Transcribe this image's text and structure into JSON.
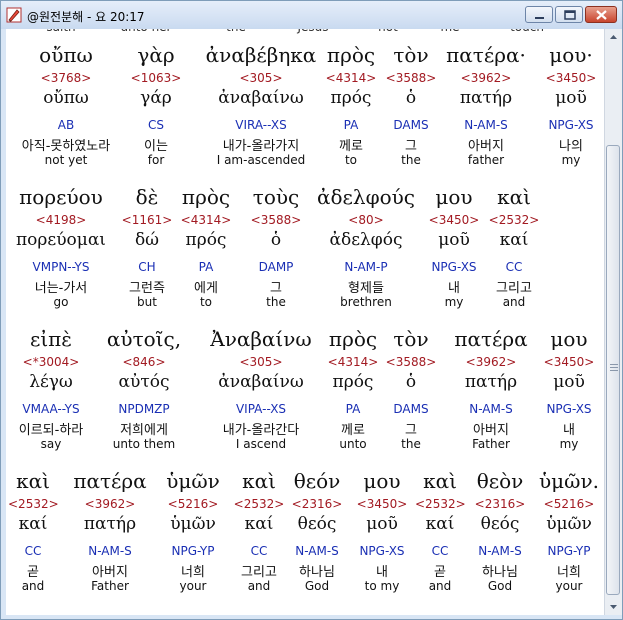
{
  "window": {
    "title": "@원전분해 - 요 20:17",
    "minimize_icon": "minimize-icon",
    "maximize_icon": "maximize-icon",
    "close_icon": "close-icon",
    "app_icon": "app-pencil-icon"
  },
  "previous_line": {
    "words": [
      "saith",
      "unto her",
      "the",
      "Jesus",
      "not",
      "me",
      "touch"
    ]
  },
  "lines": [
    {
      "words": [
        {
          "greek": "οὔπω",
          "strong": "<3768>",
          "lemma": "οὔπω",
          "morph": "AB",
          "korean": "아직-못하였노라",
          "english": "not yet"
        },
        {
          "greek": "γὰρ",
          "strong": "<1063>",
          "lemma": "γάρ",
          "morph": "CS",
          "korean": "이는",
          "english": "for"
        },
        {
          "greek": "ἀναβέβηκα",
          "strong": "<305>",
          "lemma": "ἀναβαίνω",
          "morph": "VIRA--XS",
          "korean": "내가-올라가지",
          "english": "I am-ascended"
        },
        {
          "greek": "πρὸς",
          "strong": "<4314>",
          "lemma": "πρός",
          "morph": "PA",
          "korean": "께로",
          "english": "to"
        },
        {
          "greek": "τὸν",
          "strong": "<3588>",
          "lemma": "ὁ",
          "morph": "DAMS",
          "korean": "그",
          "english": "the"
        },
        {
          "greek": "πατέρα·",
          "strong": "<3962>",
          "lemma": "πατήρ",
          "morph": "N-AM-S",
          "korean": "아버지",
          "english": "father"
        },
        {
          "greek": "μου·",
          "strong": "<3450>",
          "lemma": "μοῦ",
          "morph": "NPG-XS",
          "korean": "나의",
          "english": "my"
        }
      ]
    },
    {
      "words": [
        {
          "greek": "πορεύου",
          "strong": "<4198>",
          "lemma": "πορεύομαι",
          "morph": "VMPN--YS",
          "korean": "너는-가서",
          "english": "go"
        },
        {
          "greek": "δὲ",
          "strong": "<1161>",
          "lemma": "δώ",
          "morph": "CH",
          "korean": "그런즉",
          "english": "but"
        },
        {
          "greek": "πρὸς",
          "strong": "<4314>",
          "lemma": "πρός",
          "morph": "PA",
          "korean": "에게",
          "english": "to"
        },
        {
          "greek": "τοὺς",
          "strong": "<3588>",
          "lemma": "ὁ",
          "morph": "DAMP",
          "korean": "그",
          "english": "the"
        },
        {
          "greek": "ἀδελφούς",
          "strong": "<80>",
          "lemma": "ἀδελφός",
          "morph": "N-AM-P",
          "korean": "형제들",
          "english": "brethren"
        },
        {
          "greek": "μου",
          "strong": "<3450>",
          "lemma": "μοῦ",
          "morph": "NPG-XS",
          "korean": "내",
          "english": "my"
        },
        {
          "greek": "καὶ",
          "strong": "<2532>",
          "lemma": "καί",
          "morph": "CC",
          "korean": "그리고",
          "english": "and"
        }
      ]
    },
    {
      "words": [
        {
          "greek": "εἰπὲ",
          "strong": "<*3004>",
          "lemma": "λέγω",
          "morph": "VMAA--YS",
          "korean": "이르되-하라",
          "english": "say"
        },
        {
          "greek": "αὐτοῖς,",
          "strong": "<846>",
          "lemma": "αὐτός",
          "morph": "NPDMZP",
          "korean": "저희에게",
          "english": "unto them"
        },
        {
          "greek": "Ἀναβαίνω",
          "strong": "<305>",
          "lemma": "ἀναβαίνω",
          "morph": "VIPA--XS",
          "korean": "내가-올라간다",
          "english": "I ascend"
        },
        {
          "greek": "πρὸς",
          "strong": "<4314>",
          "lemma": "πρός",
          "morph": "PA",
          "korean": "께로",
          "english": "unto"
        },
        {
          "greek": "τὸν",
          "strong": "<3588>",
          "lemma": "ὁ",
          "morph": "DAMS",
          "korean": "그",
          "english": "the"
        },
        {
          "greek": "πατέρα",
          "strong": "<3962>",
          "lemma": "πατήρ",
          "morph": "N-AM-S",
          "korean": "아버지",
          "english": "Father"
        },
        {
          "greek": "μου",
          "strong": "<3450>",
          "lemma": "μοῦ",
          "morph": "NPG-XS",
          "korean": "내",
          "english": "my"
        }
      ]
    },
    {
      "words": [
        {
          "greek": "καὶ",
          "strong": "<2532>",
          "lemma": "καί",
          "morph": "CC",
          "korean": "곧",
          "english": "and"
        },
        {
          "greek": "πατέρα",
          "strong": "<3962>",
          "lemma": "πατήρ",
          "morph": "N-AM-S",
          "korean": "아버지",
          "english": "Father"
        },
        {
          "greek": "ὑμῶν",
          "strong": "<5216>",
          "lemma": "ὑμῶν",
          "morph": "NPG-YP",
          "korean": "너희",
          "english": "your"
        },
        {
          "greek": "καὶ",
          "strong": "<2532>",
          "lemma": "καί",
          "morph": "CC",
          "korean": "그리고",
          "english": "and"
        },
        {
          "greek": "θεόν",
          "strong": "<2316>",
          "lemma": "θεός",
          "morph": "N-AM-S",
          "korean": "하나님",
          "english": "God"
        },
        {
          "greek": "μου",
          "strong": "<3450>",
          "lemma": "μοῦ",
          "morph": "NPG-XS",
          "korean": "내",
          "english": "to my"
        },
        {
          "greek": "καὶ",
          "strong": "<2532>",
          "lemma": "καί",
          "morph": "CC",
          "korean": "곧",
          "english": "and"
        },
        {
          "greek": "θεὸν",
          "strong": "<2316>",
          "lemma": "θεός",
          "morph": "N-AM-S",
          "korean": "하나님",
          "english": "God"
        },
        {
          "greek": "ὑμῶν.",
          "strong": "<5216>",
          "lemma": "ὑμῶν",
          "morph": "NPG-YP",
          "korean": "너희",
          "english": "your"
        }
      ]
    }
  ],
  "scrollbar": {
    "up_icon": "scroll-up-arrow-icon",
    "down_icon": "scroll-down-arrow-icon"
  },
  "colors": {
    "strong_number": "#a21a22",
    "morphology": "#1a2fb4",
    "text": "#111111"
  }
}
